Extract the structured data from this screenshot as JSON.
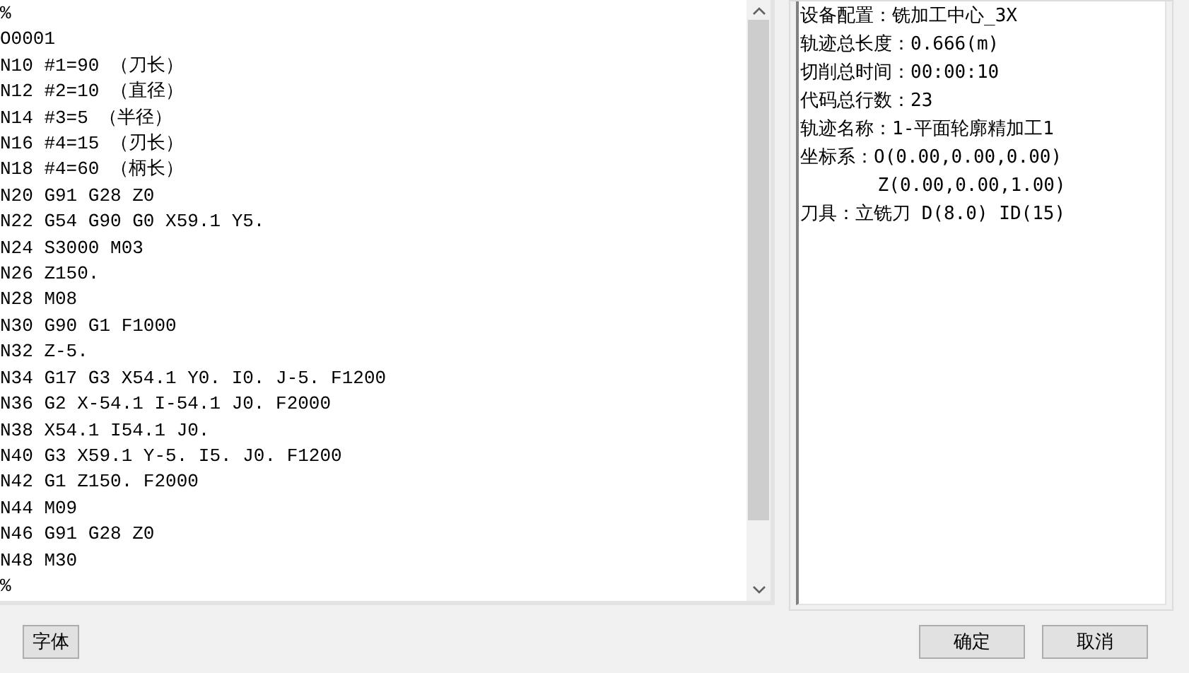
{
  "code_editor": {
    "lines": [
      "%",
      "O0001",
      "N10 #1=90 （刀长）",
      "N12 #2=10 （直径）",
      "N14 #3=5 （半径）",
      "N16 #4=15 （刃长）",
      "N18 #4=60 （柄长）",
      "N20 G91 G28 Z0",
      "N22 G54 G90 G0 X59.1 Y5.",
      "N24 S3000 M03",
      "N26 Z150.",
      "N28 M08",
      "N30 G90 G1 F1000",
      "N32 Z-5.",
      "N34 G17 G3 X54.1 Y0. I0. J-5. F1200",
      "N36 G2 X-54.1 I-54.1 J0. F2000",
      "N38 X54.1 I54.1 J0.",
      "N40 G3 X59.1 Y-5. I5. J0. F1200",
      "N42 G1 Z150. F2000",
      "N44 M09",
      "N46 G91 G28 Z0",
      "N48 M30",
      "%"
    ]
  },
  "info_panel": {
    "lines": [
      "设备配置：铣加工中心_3X",
      "轨迹总长度：0.666(m)",
      "切削总时间：00:00:10",
      "代码总行数：23",
      "轨迹名称：1-平面轮廓精加工1",
      "坐标系：O(0.00,0.00,0.00)",
      "       Z(0.00,0.00,1.00)",
      "刀具：立铣刀 D(8.0) ID(15)"
    ]
  },
  "buttons": {
    "font": "字体",
    "ok": "确定",
    "cancel": "取消"
  }
}
